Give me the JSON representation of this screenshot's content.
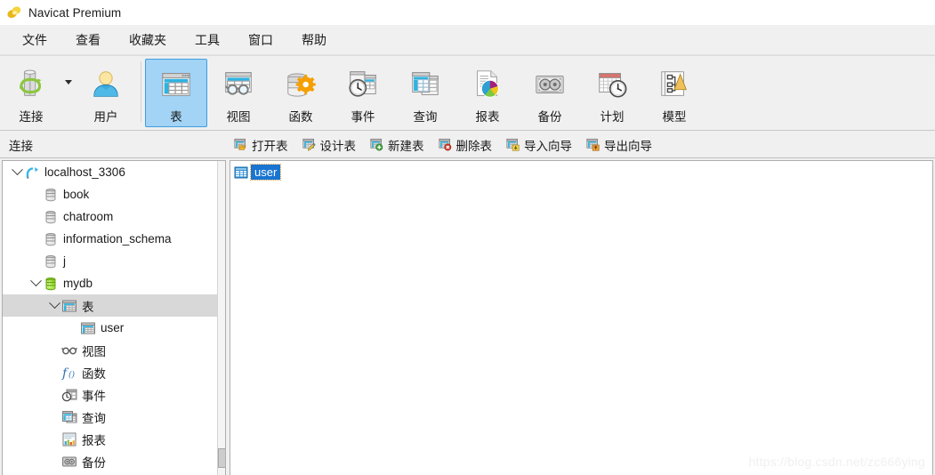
{
  "window": {
    "title": "Navicat Premium",
    "logo_icon": "navicat-logo-icon"
  },
  "menubar": {
    "items": [
      {
        "label": "文件",
        "name": "menu-file"
      },
      {
        "label": "查看",
        "name": "menu-view"
      },
      {
        "label": "收藏夹",
        "name": "menu-favorites"
      },
      {
        "label": "工具",
        "name": "menu-tools"
      },
      {
        "label": "窗口",
        "name": "menu-window"
      },
      {
        "label": "帮助",
        "name": "menu-help"
      }
    ]
  },
  "toolbar": {
    "buttons": [
      {
        "label": "连接",
        "icon": "connection-icon",
        "selected": false,
        "has_caret": true
      },
      {
        "label": "用户",
        "icon": "user-icon",
        "selected": false,
        "has_caret": false
      },
      {
        "label": "表",
        "icon": "table-icon",
        "selected": true,
        "has_caret": false
      },
      {
        "label": "视图",
        "icon": "view-icon",
        "selected": false,
        "has_caret": false
      },
      {
        "label": "函数",
        "icon": "function-icon",
        "selected": false,
        "has_caret": false
      },
      {
        "label": "事件",
        "icon": "event-icon",
        "selected": false,
        "has_caret": false
      },
      {
        "label": "查询",
        "icon": "query-icon",
        "selected": false,
        "has_caret": false
      },
      {
        "label": "报表",
        "icon": "report-icon",
        "selected": false,
        "has_caret": false
      },
      {
        "label": "备份",
        "icon": "backup-icon",
        "selected": false,
        "has_caret": false
      },
      {
        "label": "计划",
        "icon": "schedule-icon",
        "selected": false,
        "has_caret": false
      },
      {
        "label": "模型",
        "icon": "model-icon",
        "selected": false,
        "has_caret": false
      }
    ]
  },
  "subbar": {
    "connection_header": "连接",
    "actions": [
      {
        "label": "打开表",
        "icon": "open-table-icon"
      },
      {
        "label": "设计表",
        "icon": "design-table-icon"
      },
      {
        "label": "新建表",
        "icon": "new-table-icon"
      },
      {
        "label": "删除表",
        "icon": "delete-table-icon"
      },
      {
        "label": "导入向导",
        "icon": "import-wizard-icon"
      },
      {
        "label": "导出向导",
        "icon": "export-wizard-icon"
      }
    ]
  },
  "sidebar": {
    "tree": [
      {
        "label": "localhost_3306",
        "icon": "connection-node-icon",
        "depth": 0,
        "expandable": true,
        "expanded": true,
        "selected": false
      },
      {
        "label": "book",
        "icon": "database-icon",
        "depth": 1,
        "expandable": false,
        "expanded": false,
        "selected": false
      },
      {
        "label": "chatroom",
        "icon": "database-icon",
        "depth": 1,
        "expandable": false,
        "expanded": false,
        "selected": false
      },
      {
        "label": "information_schema",
        "icon": "database-icon",
        "depth": 1,
        "expandable": false,
        "expanded": false,
        "selected": false
      },
      {
        "label": "j",
        "icon": "database-icon",
        "depth": 1,
        "expandable": false,
        "expanded": false,
        "selected": false
      },
      {
        "label": "mydb",
        "icon": "database-open-icon",
        "depth": 1,
        "expandable": true,
        "expanded": true,
        "selected": false
      },
      {
        "label": "表",
        "icon": "table-folder-icon",
        "depth": 2,
        "expandable": true,
        "expanded": true,
        "selected": true
      },
      {
        "label": "user",
        "icon": "table-icon-small",
        "depth": 3,
        "expandable": false,
        "expanded": false,
        "selected": false
      },
      {
        "label": "视图",
        "icon": "view-folder-icon",
        "depth": 2,
        "expandable": false,
        "expanded": false,
        "selected": false
      },
      {
        "label": "函数",
        "icon": "function-folder-icon",
        "depth": 2,
        "expandable": false,
        "expanded": false,
        "selected": false
      },
      {
        "label": "事件",
        "icon": "event-folder-icon",
        "depth": 2,
        "expandable": false,
        "expanded": false,
        "selected": false
      },
      {
        "label": "查询",
        "icon": "query-folder-icon",
        "depth": 2,
        "expandable": false,
        "expanded": false,
        "selected": false
      },
      {
        "label": "报表",
        "icon": "report-folder-icon",
        "depth": 2,
        "expandable": false,
        "expanded": false,
        "selected": false
      },
      {
        "label": "备份",
        "icon": "backup-folder-icon",
        "depth": 2,
        "expandable": false,
        "expanded": false,
        "selected": false
      }
    ],
    "scrollbar": {
      "name": "sidebar-vertical-scrollbar"
    }
  },
  "content": {
    "objects": [
      {
        "label": "user",
        "icon": "table-object-icon",
        "selected": true
      }
    ],
    "watermark": "https://blog.csdn.net/zc666ying"
  },
  "colors": {
    "selection_blue": "#1975d1",
    "toolbar_selected": "#a3d3f5",
    "tree_selected_gray": "#d8d8d8",
    "chrome_bg": "#f0f0f0",
    "panel_bg": "#ffffff"
  }
}
